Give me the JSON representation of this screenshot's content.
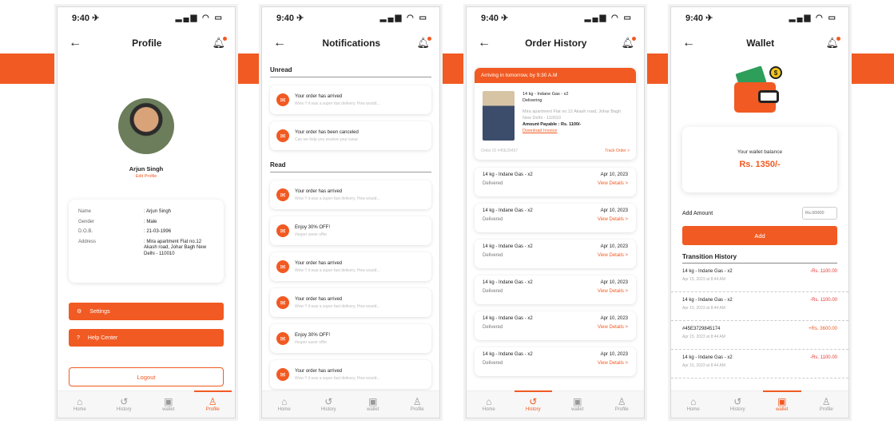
{
  "status": {
    "time": "9:40 ✈",
    "icons": "▂▄▆ ◠ ▭"
  },
  "tabbar": [
    "Home",
    "History",
    "wallet",
    "Profile"
  ],
  "profile": {
    "title": "Profile",
    "name": "Arjun Singh",
    "edit": "Edit Profile",
    "fields": [
      {
        "k": "Name",
        "v": ":  Arjun Singh"
      },
      {
        "k": "Gender",
        "v": ":  Male"
      },
      {
        "k": "D.O.B.",
        "v": ":  21-03-1996"
      },
      {
        "k": "Address",
        "v": ":  Mira apartment Flat no.12 Akash road, Johar Bagh New Delhi - 110010"
      }
    ],
    "settings": "Settings",
    "help": "Help Center",
    "logout": "Logout"
  },
  "notifications": {
    "title": "Notifications",
    "unread": "Unread",
    "read": "Read",
    "unread_items": [
      {
        "t": "Your order has arrived",
        "s": "Wow !! it was a super fast delivery. How would..."
      },
      {
        "t": "Your order has been canceled",
        "s": "Can we help you resolve your issue"
      }
    ],
    "read_items": [
      {
        "t": "Your order has arrived",
        "s": "Wow !! it was a super fast delivery. How would..."
      },
      {
        "t": "Enjoy 30% OFF!",
        "s": "#super saver offer"
      },
      {
        "t": "Your order has arrived",
        "s": "Wow !! it was a super fast delivery. How would..."
      },
      {
        "t": "Your order has arrived",
        "s": "Wow !! it was a super fast delivery. How would..."
      },
      {
        "t": "Enjoy 30% OFF!",
        "s": "#super saver offer"
      },
      {
        "t": "Your order has arrived",
        "s": "Wow !! it was a super fast delivery. How would..."
      }
    ]
  },
  "history": {
    "title": "Order History",
    "banner": "Arriving in tomorrow, by 9:30 A.M",
    "current": {
      "item": "14 kg - Indane Gas - x2",
      "status": "Delivering",
      "addr": "Mira apartment Flat no.12 Akash road, Johar Bagh New Delhi - 110010",
      "payable": "Amount Payable : Rs. 1100/-",
      "invoice": "Download Invoice",
      "order": "Order ID #45E29457",
      "track": "Track Order >"
    },
    "items": [
      {
        "item": "14 kg - Indane Gas - x2",
        "status": "Delivered",
        "date": "Apr 10, 2023",
        "link": "View Details >"
      },
      {
        "item": "14 kg - Indane Gas - x2",
        "status": "Delivered",
        "date": "Apr 10, 2023",
        "link": "View Details >"
      },
      {
        "item": "14 kg - Indane Gas - x2",
        "status": "Delivered",
        "date": "Apr 10, 2023",
        "link": "View Details >"
      },
      {
        "item": "14 kg - Indane Gas - x2",
        "status": "Delivered",
        "date": "Apr 10, 2023",
        "link": "View Details >"
      },
      {
        "item": "14 kg - Indane Gas - x2",
        "status": "Delivered",
        "date": "Apr 10, 2023",
        "link": "View Details >"
      },
      {
        "item": "14 kg - Indane Gas - x2",
        "status": "Delivered",
        "date": "Apr 10, 2023",
        "link": "View Details >"
      }
    ]
  },
  "wallet": {
    "title": "Wallet",
    "coin": "$",
    "balance_label": "Your wallet balance",
    "balance": "Rs. 1350/-",
    "add_label": "Add Amount",
    "add_placeholder": "Rs.00000",
    "add_button": "Add",
    "transitions_title": "Transition History",
    "transitions": [
      {
        "t": "14 kg - Indane Gas - x2",
        "d": "Apr 15, 2023 at 8:44 AM",
        "a": "-Rs. 1100.00",
        "neg": true
      },
      {
        "t": "14 kg - Indane Gas - x2",
        "d": "Apr 15, 2023 at 8:44 AM",
        "a": "-Rs. 1100.00",
        "neg": true
      },
      {
        "t": "#45E3729845174",
        "d": "Apr 15, 2023 at 8:44 AM",
        "a": "+Rs. 3600.00",
        "neg": false
      },
      {
        "t": "14 kg - Indane Gas - x2",
        "d": "Apr 15, 2023 at 8:44 AM",
        "a": "-Rs. 1100.00",
        "neg": true
      }
    ]
  }
}
